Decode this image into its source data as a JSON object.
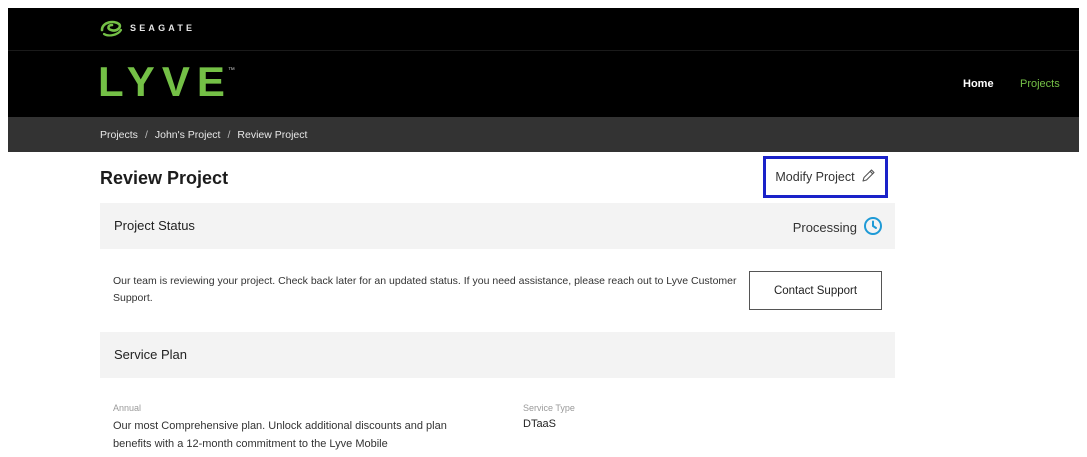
{
  "brand": {
    "seagate_text": "SEAGATE",
    "lyve_text": "LYVE",
    "lyve_tm": "™",
    "accent_color": "#74c046"
  },
  "nav": {
    "home_label": "Home",
    "projects_label": "Projects"
  },
  "breadcrumb": {
    "items": [
      "Projects",
      "John's Project",
      "Review Project"
    ],
    "separator": "/"
  },
  "page": {
    "title": "Review Project",
    "modify_label": "Modify Project",
    "modify_icon": "pencil-icon"
  },
  "status_panel": {
    "title": "Project Status",
    "status": "Processing",
    "status_icon": "clock-icon",
    "status_icon_color": "#1e9ad6",
    "message": "Our team is reviewing your project. Check back later for an updated status. If you need assistance, please reach out to Lyve Customer Support.",
    "contact_label": "Contact Support"
  },
  "plan_panel": {
    "title": "Service Plan",
    "plan_label": "Annual",
    "plan_description": "Our most Comprehensive plan. Unlock additional discounts and plan benefits with a 12-month commitment to the Lyve Mobile",
    "service_type_label": "Service Type",
    "service_type_value": "DTaaS"
  }
}
